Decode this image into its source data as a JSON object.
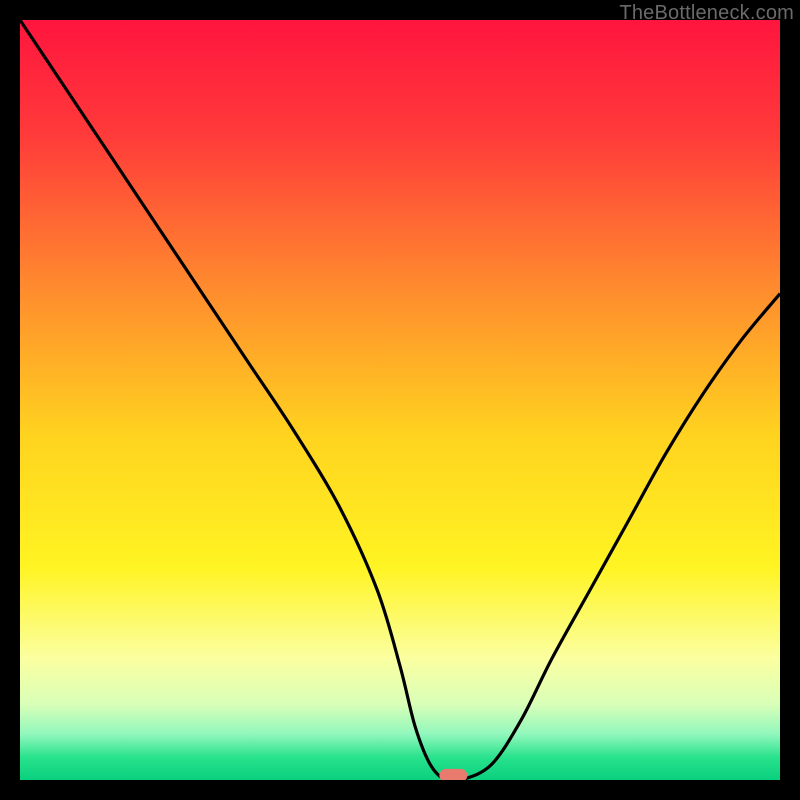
{
  "watermark": "TheBottleneck.com",
  "chart_data": {
    "type": "line",
    "title": "",
    "xlabel": "",
    "ylabel": "",
    "xlim": [
      0,
      100
    ],
    "ylim": [
      0,
      100
    ],
    "grid": false,
    "series": [
      {
        "name": "bottleneck-curve",
        "x": [
          0,
          6,
          12,
          18,
          24,
          30,
          36,
          42,
          47,
          50,
          52,
          54,
          56,
          58,
          62,
          66,
          70,
          75,
          80,
          85,
          90,
          95,
          100
        ],
        "values": [
          100,
          91,
          82,
          73,
          64,
          55,
          46,
          36,
          25,
          15,
          7,
          2,
          0,
          0,
          2,
          8,
          16,
          25,
          34,
          43,
          51,
          58,
          64
        ]
      }
    ],
    "marker": {
      "x": 57,
      "y": 0,
      "color": "#e97a6e",
      "w_pct": 3.6,
      "h_pct": 1.6
    },
    "gradient_stops": [
      {
        "pct": 0,
        "color": "#ff153e"
      },
      {
        "pct": 15,
        "color": "#ff3a3a"
      },
      {
        "pct": 35,
        "color": "#ff8a2e"
      },
      {
        "pct": 55,
        "color": "#ffd41f"
      },
      {
        "pct": 72,
        "color": "#fff423"
      },
      {
        "pct": 84,
        "color": "#fbffa0"
      },
      {
        "pct": 90,
        "color": "#d9ffb8"
      },
      {
        "pct": 94,
        "color": "#90f7bc"
      },
      {
        "pct": 97,
        "color": "#29e28c"
      },
      {
        "pct": 100,
        "color": "#0ad07e"
      }
    ]
  }
}
